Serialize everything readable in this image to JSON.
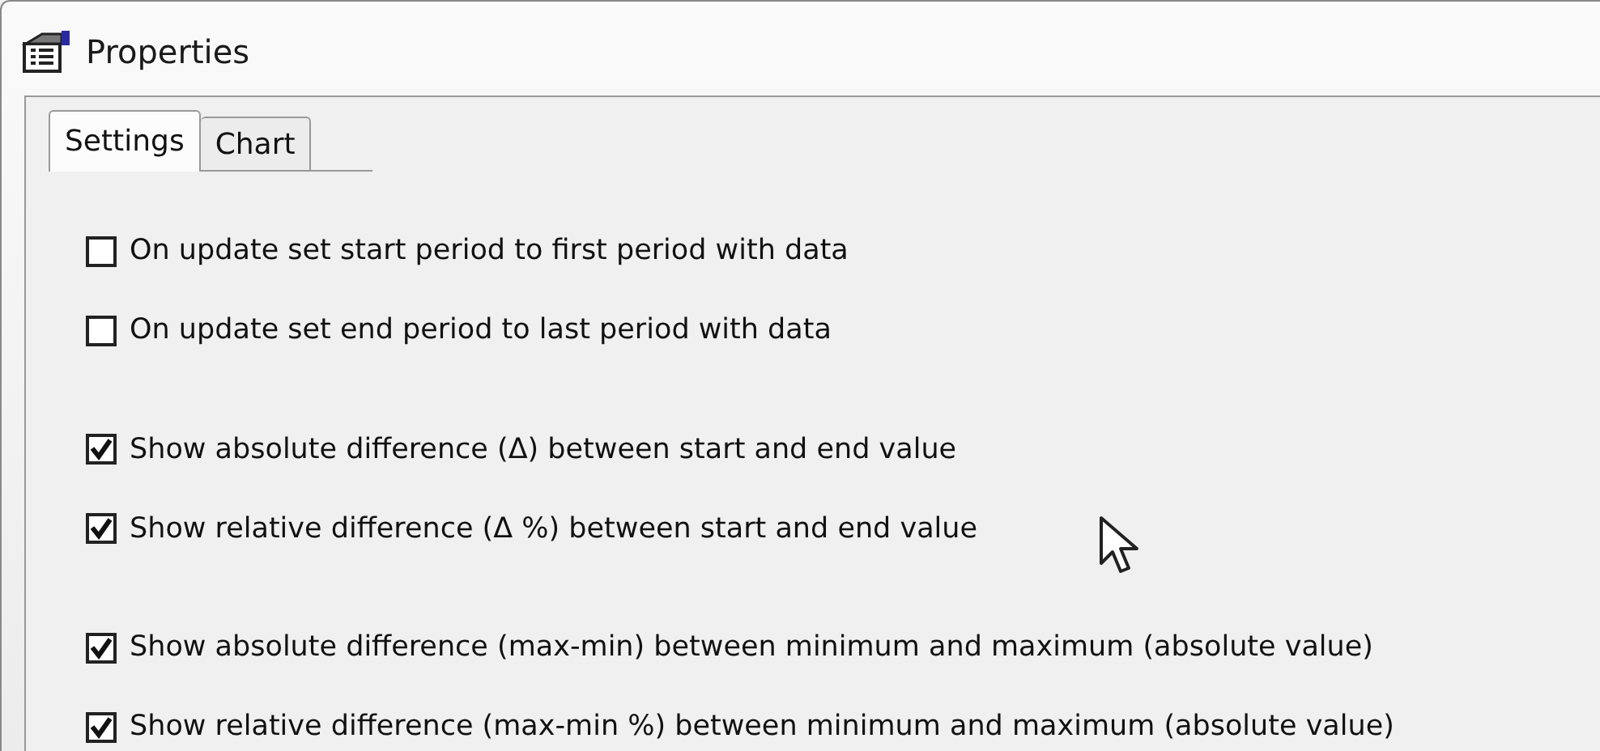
{
  "window": {
    "title": "Properties"
  },
  "tabs": [
    {
      "label": "Settings",
      "selected": true
    },
    {
      "label": "Chart",
      "selected": false
    }
  ],
  "option_groups": [
    [
      {
        "label": "On update set start period to first period with data",
        "checked": false
      },
      {
        "label": "On update set end period to last period with data",
        "checked": false
      }
    ],
    [
      {
        "label": "Show absolute difference (Δ) between start and end value",
        "checked": true
      },
      {
        "label": "Show relative difference (Δ %) between start and end value",
        "checked": true
      }
    ],
    [
      {
        "label": "Show absolute difference (max-min) between minimum and maximum (absolute value)",
        "checked": true
      },
      {
        "label": "Show relative difference (max-min %) between minimum and maximum (absolute value)",
        "checked": true
      }
    ]
  ]
}
